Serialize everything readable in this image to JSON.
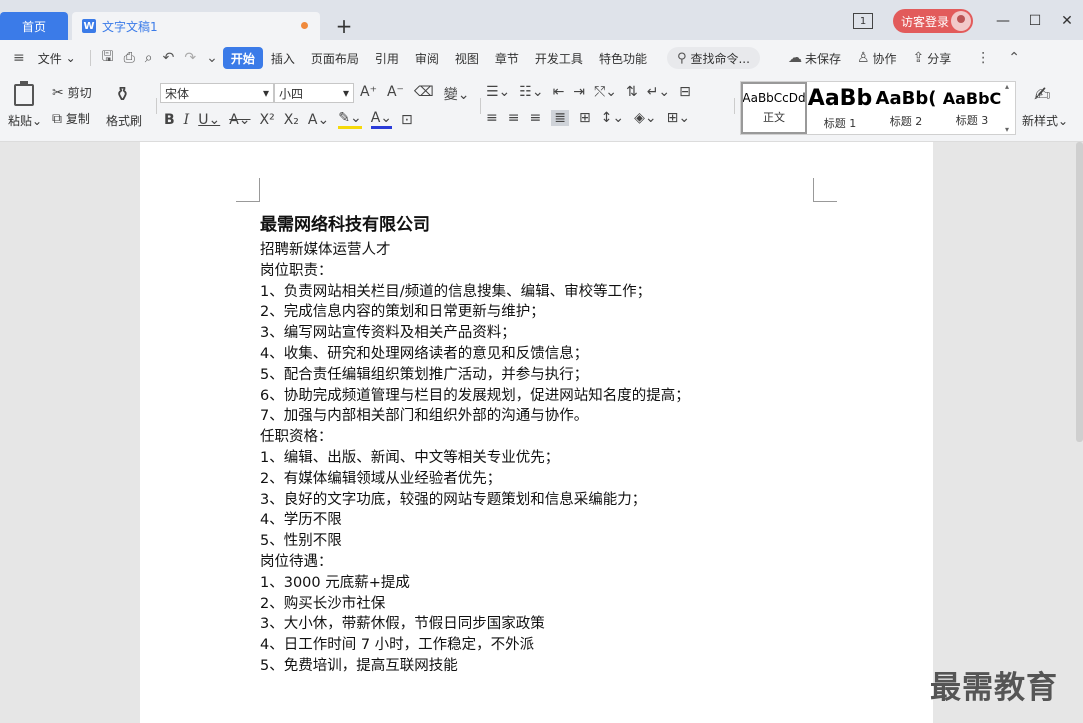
{
  "tabs": {
    "home": "首页",
    "doc": "文字文稿1",
    "page_indicator": "1",
    "login": "访客登录"
  },
  "menu": {
    "file": "文件",
    "items": [
      "开始",
      "插入",
      "页面布局",
      "引用",
      "审阅",
      "视图",
      "章节",
      "开发工具",
      "特色功能"
    ],
    "search": "查找命令...",
    "unsaved": "未保存",
    "collab": "协作",
    "share": "分享"
  },
  "ribbon": {
    "paste": "粘贴",
    "cut": "剪切",
    "copy": "复制",
    "format_painter": "格式刷",
    "font_name": "宋体",
    "font_size": "小四",
    "new_style": "新样式",
    "styles": [
      {
        "sample": "AaBbCcDd",
        "name": "正文"
      },
      {
        "sample": "AaBb",
        "name": "标题 1"
      },
      {
        "sample": "AaBb(",
        "name": "标题 2"
      },
      {
        "sample": "AaBbC",
        "name": "标题 3"
      }
    ]
  },
  "document": {
    "title": "最需网络科技有限公司",
    "lines": [
      "招聘新媒体运营人才",
      "岗位职责：",
      "1、负责网站相关栏目/频道的信息搜集、编辑、审校等工作；",
      "2、完成信息内容的策划和日常更新与维护；",
      "3、编写网站宣传资料及相关产品资料；",
      "4、收集、研究和处理网络读者的意见和反馈信息；",
      "5、配合责任编辑组织策划推广活动，并参与执行；",
      "6、协助完成频道管理与栏目的发展规划，促进网站知名度的提高；",
      "7、加强与内部相关部门和组织外部的沟通与协作。",
      "任职资格：",
      "1、编辑、出版、新闻、中文等相关专业优先；",
      "2、有媒体编辑领域从业经验者优先；",
      "3、良好的文字功底，较强的网站专题策划和信息采编能力；",
      "4、学历不限",
      "5、性别不限",
      "岗位待遇：",
      "1、3000 元底薪+提成",
      "2、购买长沙市社保",
      "3、大小休，带薪休假，节假日同步国家政策",
      "4、日工作时间 7 小时，工作稳定，不外派",
      "5、免费培训，提高互联网技能"
    ]
  },
  "watermark": "最需教育"
}
